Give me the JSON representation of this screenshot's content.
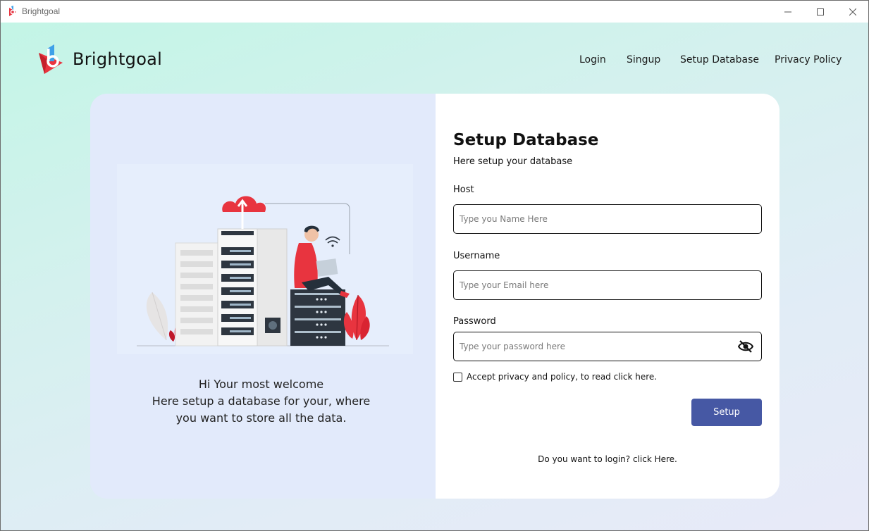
{
  "window": {
    "title": "Brightgoal",
    "controls": [
      "minimize-icon",
      "maximize-icon",
      "close-icon"
    ]
  },
  "header": {
    "brand": "Brightgoal",
    "nav": {
      "login": "Login",
      "signup": "Singup",
      "setup_database": "Setup Database",
      "privacy_policy": "Privacy Policy"
    }
  },
  "left_panel": {
    "welcome_line1": "Hi Your most welcome",
    "welcome_line2": "Here setup a database for your, where",
    "welcome_line3": "you want to store all the data."
  },
  "form": {
    "title": "Setup Database",
    "subtitle": "Here setup your database",
    "host": {
      "label": "Host",
      "placeholder": "Type you Name Here",
      "value": ""
    },
    "username": {
      "label": "Username",
      "placeholder": "Type your Email here",
      "value": ""
    },
    "password": {
      "label": "Password",
      "placeholder": "Type your password here",
      "value": ""
    },
    "accept_text": "Accept privacy and policy, to read click here.",
    "accept_checked": false,
    "submit_label": "Setup",
    "login_prompt": "Do you want to login? click Here."
  },
  "colors": {
    "accent": "#4658a4",
    "brand_red": "#e8343f",
    "brand_blue": "#3fa0e8",
    "panel_left": "#e2eafb"
  }
}
